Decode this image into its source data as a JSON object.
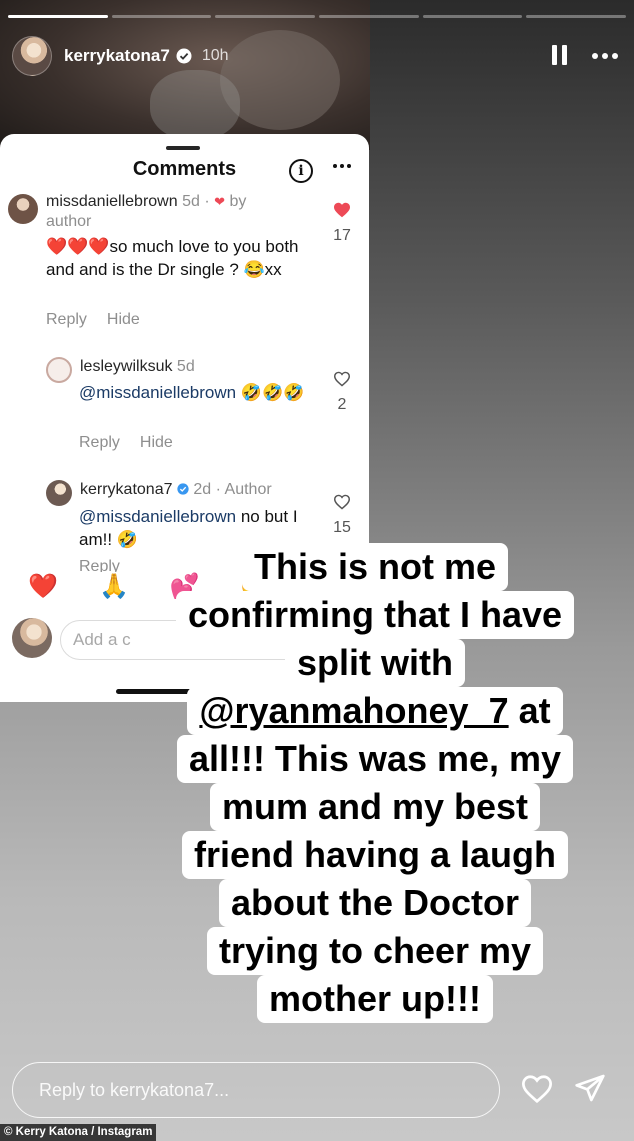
{
  "story": {
    "username": "kerrykatona7",
    "time": "10h",
    "progress_segments": [
      true,
      false,
      false,
      false,
      false,
      false
    ]
  },
  "comments_sheet": {
    "title": "Comments",
    "comments": [
      {
        "username": "missdaniellebrown",
        "meta": "5d · ",
        "meta_suffix": "by",
        "meta_line2": "author",
        "text": "❤️❤️❤️so much love to you both and and is the Dr single ? 😂xx",
        "reply": "Reply",
        "hide": "Hide",
        "likes": "17"
      },
      {
        "username": "lesleywilksuk",
        "meta": "5d",
        "mention": "@missdaniellebrown",
        "text": " 🤣🤣🤣",
        "reply": "Reply",
        "hide": "Hide",
        "likes": "2"
      },
      {
        "username": "kerrykatona7",
        "meta": " 2d · Author",
        "mention": "@missdaniellebrown",
        "text": " no but I am!! 🤣",
        "reply": "Reply",
        "likes": "15"
      }
    ],
    "emoji_reactions": [
      "❤️",
      "🙏",
      "💕",
      "😍",
      "😮"
    ],
    "add_placeholder": "Add a c"
  },
  "overlay_text": {
    "lines": [
      "This is not me",
      "confirming that I have",
      "split with",
      "@ryanmahoney_7 at",
      "all!!! This was me, my",
      "mum and my best",
      "friend having a laugh",
      "about the Doctor",
      "trying to cheer my",
      "mother up!!!"
    ],
    "mention_handle": "@ryanmahoney_7",
    "mention_rest": " at"
  },
  "reply_bar": {
    "placeholder": "Reply to kerrykatona7..."
  },
  "caption": "© Kerry Katona / Instagram",
  "colors": {
    "like_red": "#ed4956",
    "verified_blue": "#3897f0"
  }
}
